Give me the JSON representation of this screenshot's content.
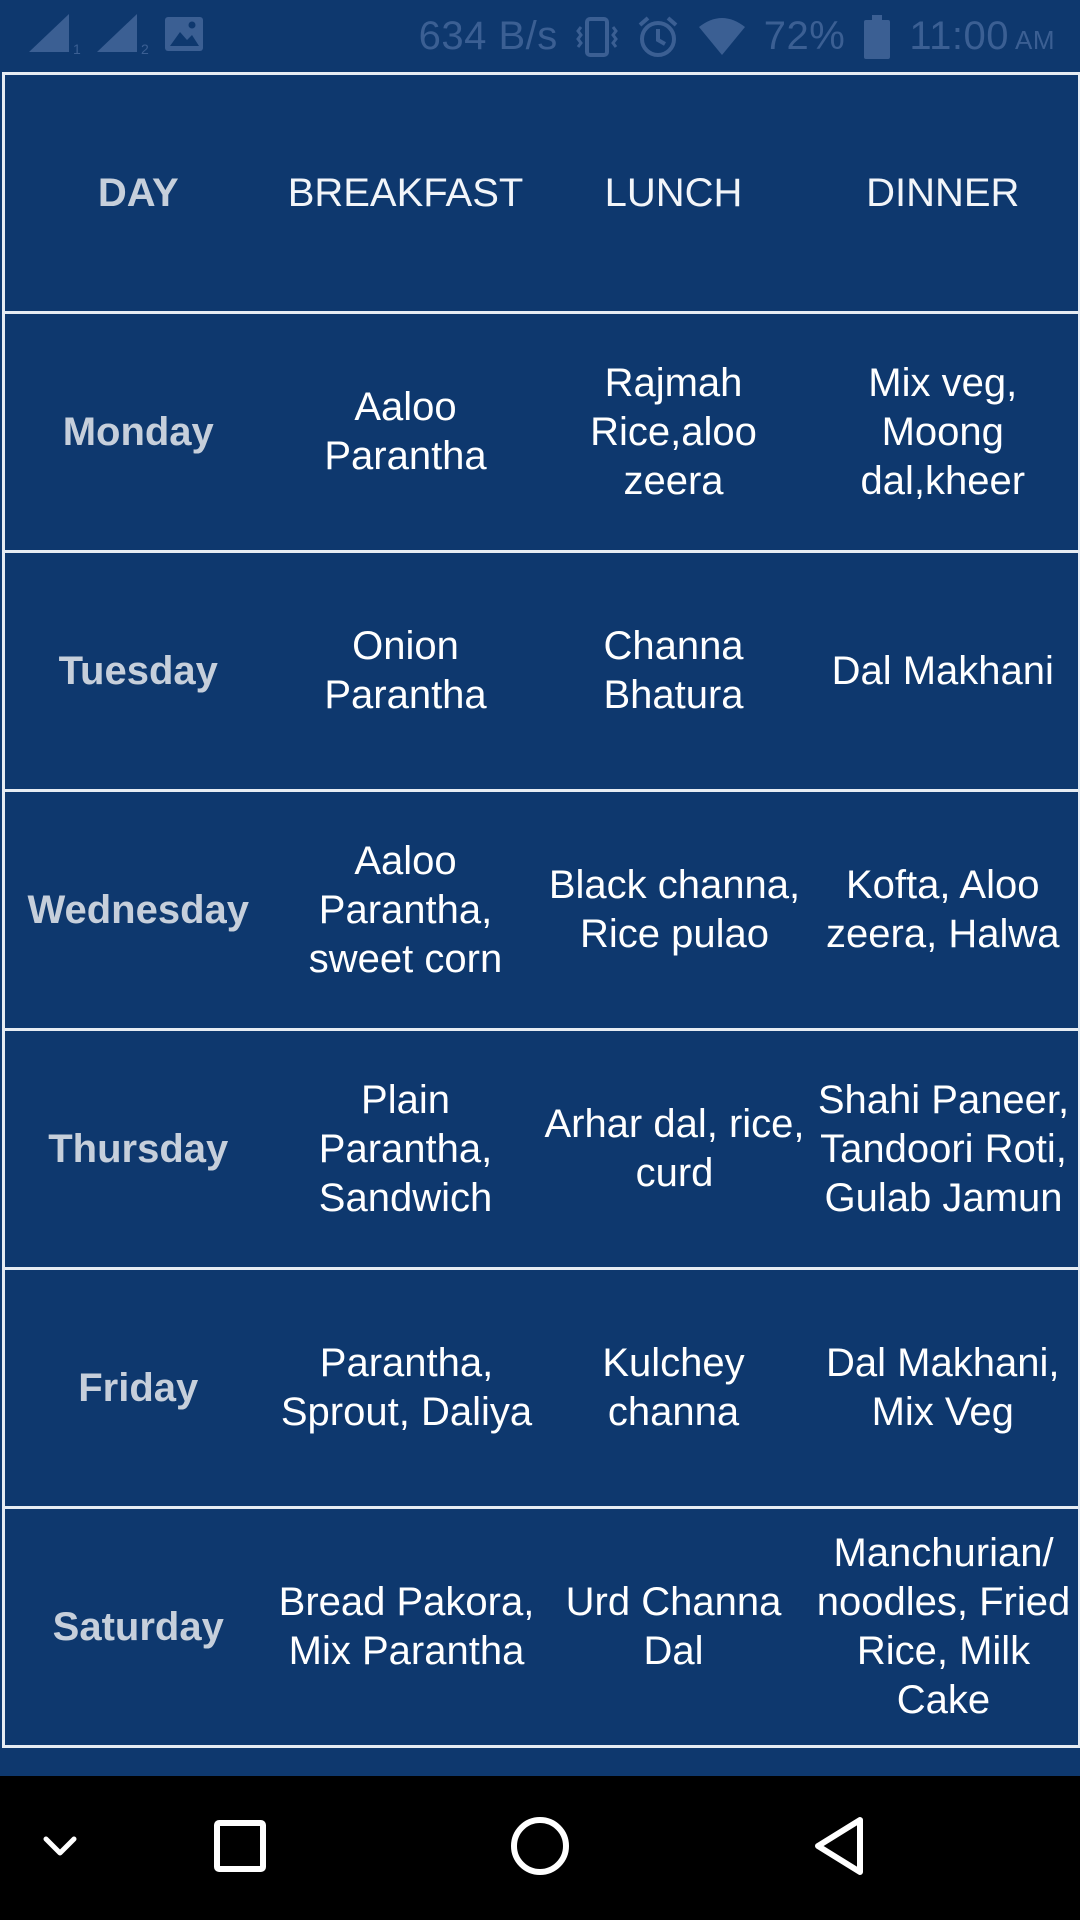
{
  "status_bar": {
    "network_speed": "634 B/s",
    "battery_percent": "72%",
    "time": "11:00",
    "ampm": "AM",
    "sim1_label": "1",
    "sim2_label": "2",
    "icons": [
      "signal-sim1-icon",
      "signal-sim2-icon",
      "image-notification-icon",
      "vibrate-icon",
      "alarm-icon",
      "wifi-icon",
      "battery-icon"
    ],
    "icon_color": "#3B5F93"
  },
  "table": {
    "header": {
      "day": "DAY",
      "breakfast": "BREAKFAST",
      "lunch": "LUNCH",
      "dinner": "DINNER"
    },
    "rows": [
      {
        "day": "Monday",
        "breakfast": "Aaloo Parantha",
        "lunch": "Rajmah Rice,aloo zeera",
        "dinner": "Mix veg, Moong dal,kheer"
      },
      {
        "day": "Tuesday",
        "breakfast": "Onion Parantha",
        "lunch": "Channa Bhatura",
        "dinner": "Dal Makhani"
      },
      {
        "day": "Wednesday",
        "breakfast": "Aaloo Parantha, sweet corn",
        "lunch": "Black channa, Rice pulao",
        "dinner": "Kofta, Aloo zeera, Halwa"
      },
      {
        "day": "Thursday",
        "breakfast": "Plain Parantha, Sandwich",
        "lunch": "Arhar dal, rice, curd",
        "dinner": "Shahi Paneer, Tandoori Roti, Gulab Jamun"
      },
      {
        "day": "Friday",
        "breakfast": "Parantha, Sprout, Daliya",
        "lunch": "Kulchey channa",
        "dinner": "Dal Makhani, Mix Veg"
      },
      {
        "day": "Saturday",
        "breakfast": "Bread Pakora, Mix Parantha",
        "lunch": "Urd Channa Dal",
        "dinner": "Manchurian/ noodles, Fried Rice, Milk Cake"
      }
    ]
  },
  "nav_bar": {
    "icons": [
      "collapse-keyboard-icon",
      "recents-icon",
      "home-icon",
      "back-icon"
    ]
  },
  "colors": {
    "background": "#0E386E",
    "cell_border": "#E6ECF3",
    "day_text": "#C6CFDB",
    "meal_text": "#FFFFFF",
    "nav_background": "#000000"
  }
}
